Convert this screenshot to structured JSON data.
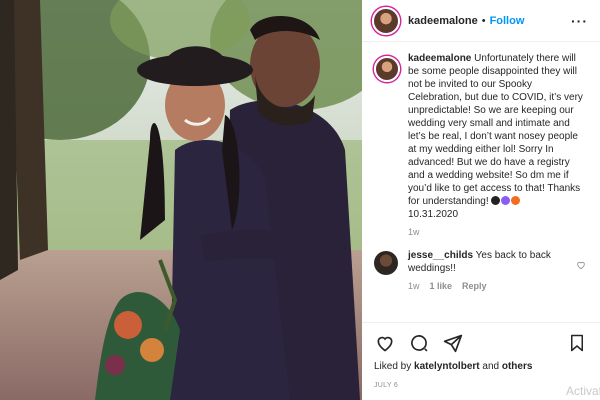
{
  "post": {
    "username": "kadeemalone",
    "header_separator": "•",
    "follow_label": "Follow",
    "more_label": "···"
  },
  "caption": {
    "username": "kadeemalone",
    "text": "Unfortunately there will be some people disappointed they will not be invited to our Spooky Celebration, but due to COVID, it’s very unpredictable! So we are keeping our wedding very small and intimate and let’s be real, I don’t want nosey people at my wedding either lol! Sorry In advanced! But we do have a registry and a wedding website! So dm me if you’d like to get access to that! Thanks for understanding!",
    "date_tag": "10.31.2020",
    "emoji_colors": [
      "#222222",
      "#8a5cf6",
      "#f26d1d"
    ],
    "timestamp": "1w"
  },
  "comments": [
    {
      "username": "jesse__childs",
      "text": "Yes back to back weddings!!",
      "time": "1w",
      "likes": "1 like",
      "reply": "Reply"
    }
  ],
  "actions": {
    "liked_by_prefix": "Liked by",
    "liked_by_user": "katelyntolbert",
    "liked_by_and": "and",
    "liked_by_others": "others",
    "date": "JULY 6"
  },
  "overlay": {
    "watermark": "Activat"
  },
  "icons": [
    "heart-icon",
    "comment-icon",
    "share-icon",
    "bookmark-icon",
    "more-icon"
  ]
}
